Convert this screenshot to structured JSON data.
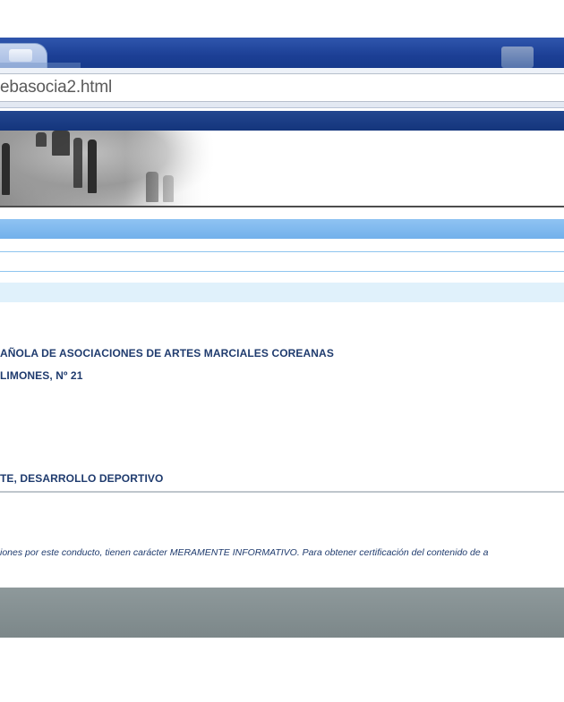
{
  "browser": {
    "address": "ebasocia2.html",
    "colors": {
      "chrome": "#1c3f95",
      "tab": "#c6d5ee"
    }
  },
  "site": {
    "colors": {
      "nav_strip": "#1d3e88",
      "bar_light": "#7fb8ee",
      "bar_pale": "#e0f1fb",
      "text": "#1f3b6e",
      "footer": "#848f91"
    }
  },
  "content": {
    "association_name": "AÑOLA DE ASOCIACIONES DE ARTES MARCIALES COREANAS",
    "address_line": "LIMONES, Nº 21",
    "purpose": "TE, DESARROLLO DEPORTIVO",
    "disclaimer": "iones por este conducto, tienen carácter MERAMENTE INFORMATIVO. Para obtener certificación del contenido de a"
  }
}
